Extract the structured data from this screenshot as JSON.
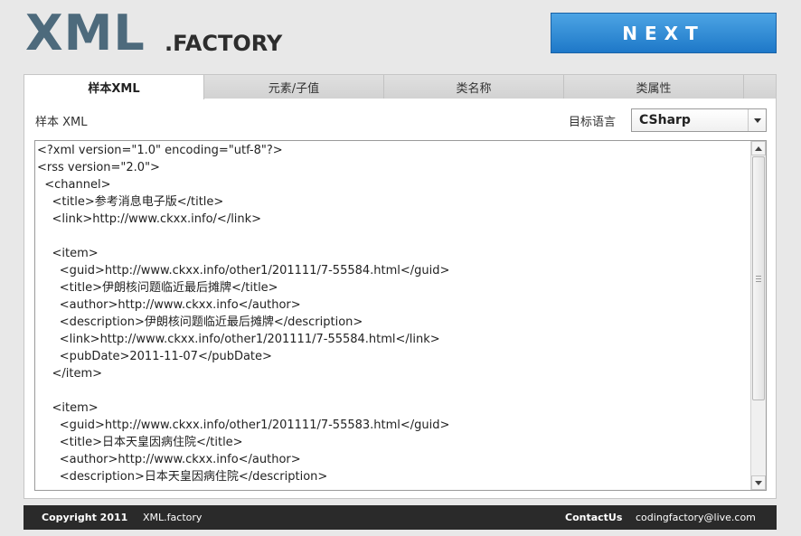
{
  "logo": {
    "main": "XML",
    "suffix": ".FACTORY"
  },
  "header": {
    "next_label": "NEXT"
  },
  "tabs": [
    {
      "label": "样本XML"
    },
    {
      "label": "元素/子值"
    },
    {
      "label": "类名称"
    },
    {
      "label": "类属性"
    }
  ],
  "panel": {
    "sample_label": "样本 XML",
    "language_label": "目标语言",
    "language_value": "CSharp"
  },
  "editor": {
    "lines": [
      "<?xml version=\"1.0\" encoding=\"utf-8\"?>",
      "<rss version=\"2.0\">",
      "  <channel>",
      "    <title>参考消息电子版</title>",
      "    <link>http://www.ckxx.info/</link>",
      "",
      "    <item>",
      "      <guid>http://www.ckxx.info/other1/201111/7-55584.html</guid>",
      "      <title>伊朗核问题临近最后摊牌</title>",
      "      <author>http://www.ckxx.info</author>",
      "      <description>伊朗核问题临近最后摊牌</description>",
      "      <link>http://www.ckxx.info/other1/201111/7-55584.html</link>",
      "      <pubDate>2011-11-07</pubDate>",
      "    </item>",
      "",
      "    <item>",
      "      <guid>http://www.ckxx.info/other1/201111/7-55583.html</guid>",
      "      <title>日本天皇因病住院</title>",
      "      <author>http://www.ckxx.info</author>",
      "      <description>日本天皇因病住院</description>"
    ]
  },
  "footer": {
    "copyright": "Copyright 2011",
    "brand": "XML.factory",
    "contact_label": "ContactUs",
    "email": "codingfactory@live.com"
  },
  "colors": {
    "logo_main": "#4d6a7c",
    "next_button": "#2a8ad6",
    "footer_bg": "#2a2a2a"
  }
}
